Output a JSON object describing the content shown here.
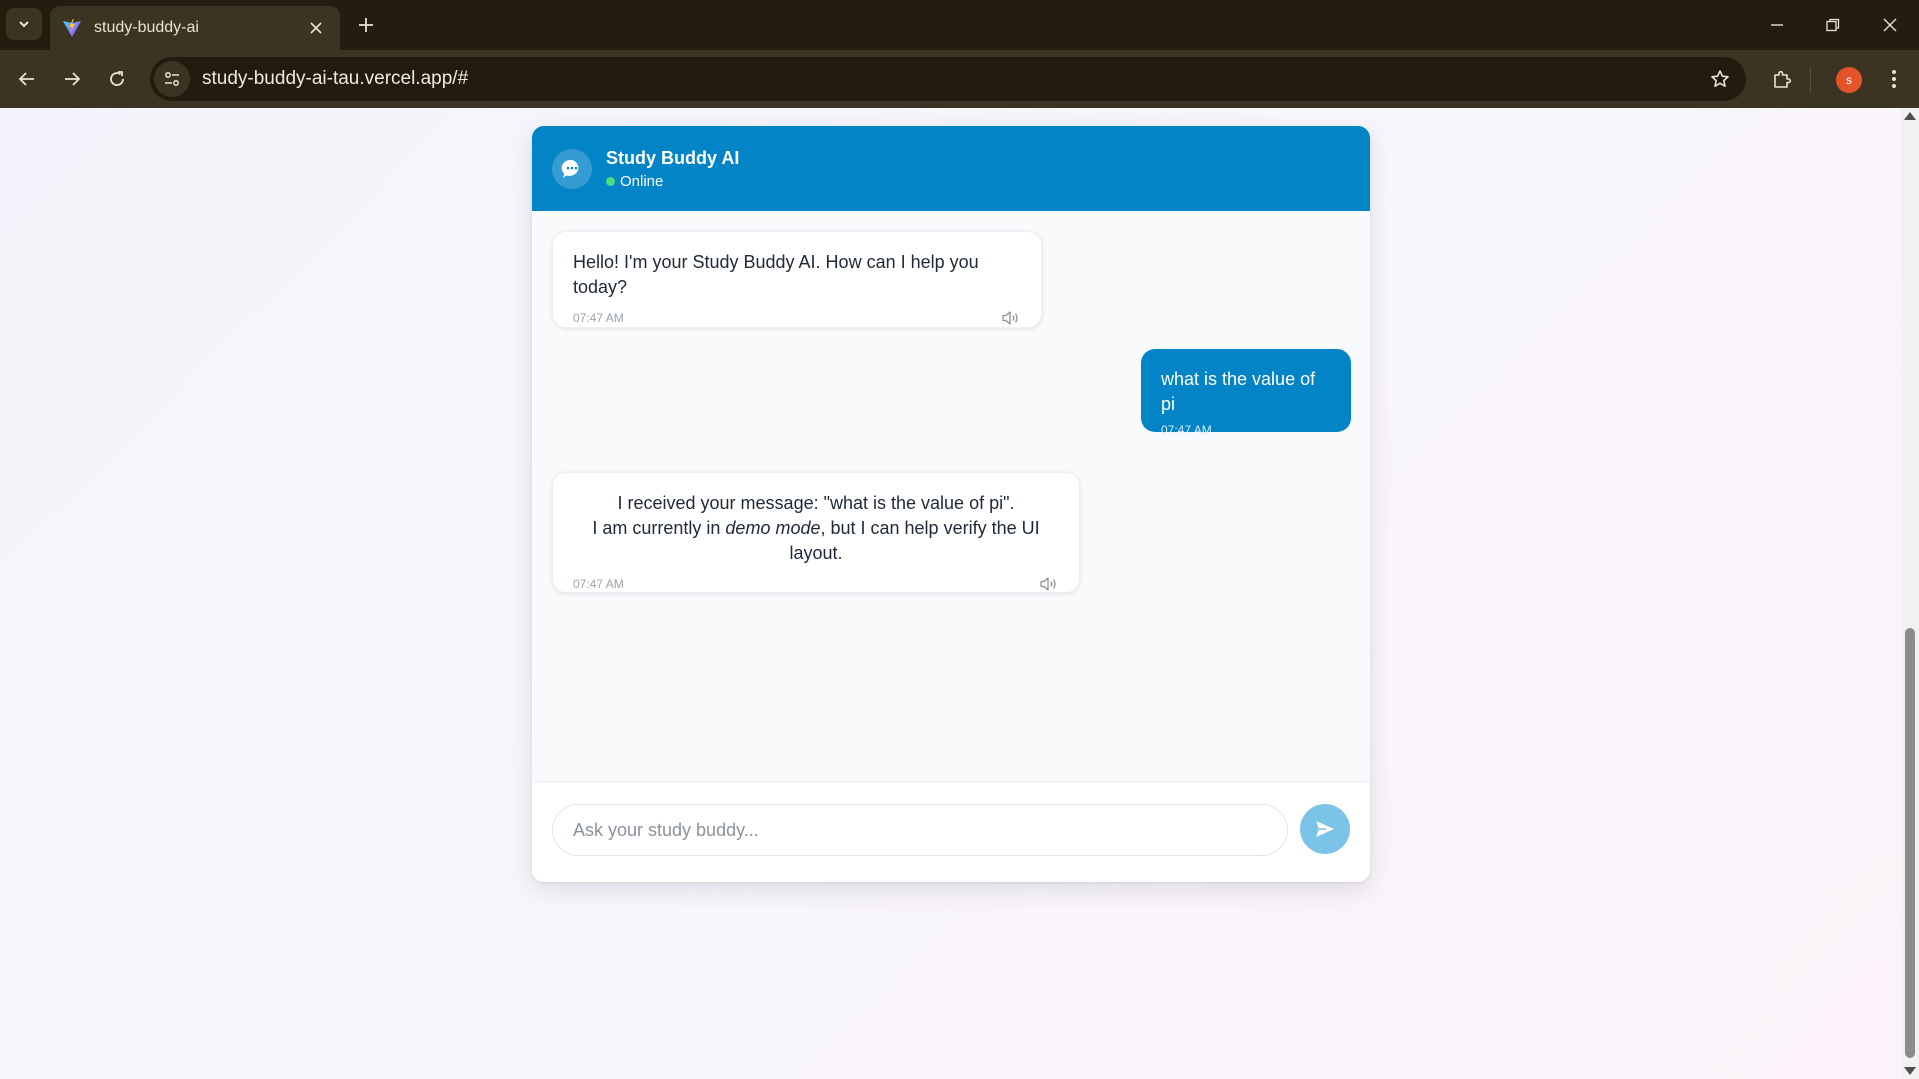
{
  "browser": {
    "tab_title": "study-buddy-ai",
    "url": "study-buddy-ai-tau.vercel.app/#",
    "profile_initial": "s"
  },
  "chat": {
    "bot_name": "Study Buddy AI",
    "status": "Online",
    "colors": {
      "header": "#0284c7",
      "user_bubble": "#0284c7",
      "online_dot": "#4ade80",
      "send_button": "#7cc4e7"
    },
    "messages": [
      {
        "role": "bot",
        "text": "Hello! I'm your Study Buddy AI. How can I help you today?",
        "time": "07:47 AM"
      },
      {
        "role": "user",
        "text": "what is the value of pi",
        "time": "07:47 AM"
      },
      {
        "role": "bot",
        "line1": "I received your message: \"what is the value of pi\".",
        "line2_prefix": "I am currently in ",
        "line2_emphasis": "demo mode",
        "line2_suffix": ", but I can help verify the UI layout.",
        "time": "07:47 AM"
      }
    ],
    "input_placeholder": "Ask your study buddy...",
    "input_value": ""
  }
}
